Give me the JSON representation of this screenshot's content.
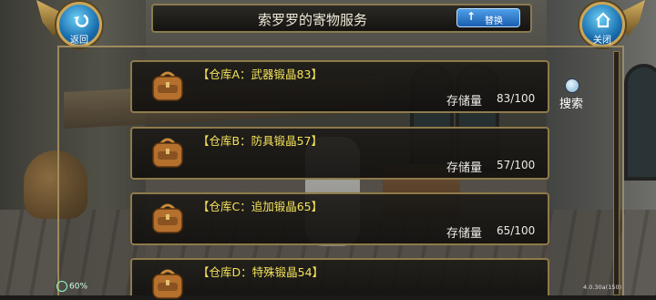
{
  "header": {
    "title": "索罗罗的寄物服务",
    "switch_label": "替换",
    "back_label": "返回",
    "close_label": "关闭"
  },
  "search": {
    "label": "搜索",
    "icon": "magnifier-icon"
  },
  "warehouses": [
    {
      "name": "【仓库A：武器锻晶83】",
      "capacity_label": "存储量",
      "capacity_value": "83/100",
      "icon": "bag-icon"
    },
    {
      "name": "【仓库B：防具锻晶57】",
      "capacity_label": "存储量",
      "capacity_value": "57/100",
      "icon": "bag-icon"
    },
    {
      "name": "【仓库C：追加锻晶65】",
      "capacity_label": "存储量",
      "capacity_value": "65/100",
      "icon": "bag-icon"
    },
    {
      "name": "【仓库D：特殊锻晶54】",
      "capacity_label": "",
      "capacity_value": "",
      "icon": "bag-icon"
    }
  ],
  "status": {
    "battery": "60%",
    "version": "4.0.30a(150)"
  },
  "colors": {
    "item_title": "#f3e25a",
    "frame_gold": "#9e8a5c",
    "button_blue": "#1a6fb0"
  }
}
